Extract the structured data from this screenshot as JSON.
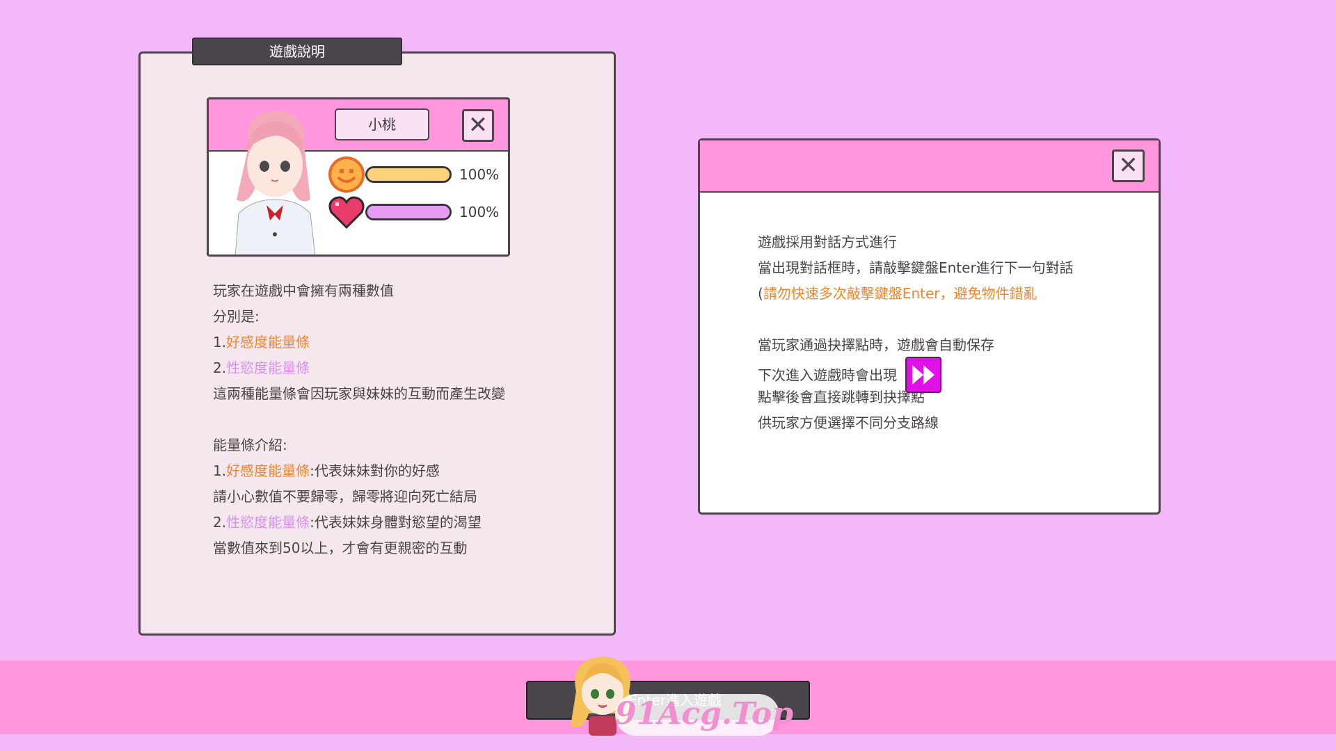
{
  "left_panel": {
    "tab_title": "遊戲說明",
    "card": {
      "name": "小桃",
      "close_icon": "✕",
      "favor_value": "100%",
      "lust_value": "100%",
      "favor_level": 1.0,
      "lust_level": 1.0
    },
    "lines": {
      "l1": "玩家在遊戲中會擁有兩種數值",
      "l2": "分別是:",
      "l3_num": "1.",
      "l3_hl": "好感度能量條",
      "l4_num": "2.",
      "l4_hl": "性慾度能量條",
      "l5": "這兩種能量條會因玩家與妹妹的互動而產生改變",
      "l6": "能量條介紹:",
      "l7_num": "1.",
      "l7_hl": "好感度能量條",
      "l7_rest": ":代表妹妹對你的好感",
      "l8": "請小心數值不要歸零，歸零將迎向死亡結局",
      "l9_num": "2.",
      "l9_hl": "性慾度能量條",
      "l9_rest": ":代表妹妹身體對慾望的渴望",
      "l10": "當數值來到50以上，才會有更親密的互動"
    }
  },
  "right_panel": {
    "close_icon": "✕",
    "lines": {
      "r1": "遊戲採用對話方式進行",
      "r2": "當出現對話框時，請敲擊鍵盤Enter進行下一句對話",
      "r3_paren": "(",
      "r3_hl": "請勿快速多次敲擊鍵盤Enter，避免物件錯亂",
      "r4": "當玩家通過抉擇點時，遊戲會自動保存",
      "r5": "下次進入遊戲時會出現",
      "r6": "點擊後會直接跳轉到抉擇點",
      "r7": "供玩家方便選擇不同分支路線"
    }
  },
  "bottom": {
    "start_label": "按Enter進入遊戲",
    "watermark": "91Acg.Top"
  },
  "colors": {
    "background": "#f2b8f8",
    "header_pink": "#ff96de",
    "highlight_orange": "#f0862e",
    "highlight_violet": "#da8ff0",
    "favor_bar": "#ffd27a",
    "lust_bar": "#e59cf2",
    "fast_forward": "#e011e6"
  },
  "icons": {
    "favor": "smiley-face-icon",
    "lust": "heart-icon",
    "skip": "fast-forward-icon",
    "close": "close-icon"
  }
}
